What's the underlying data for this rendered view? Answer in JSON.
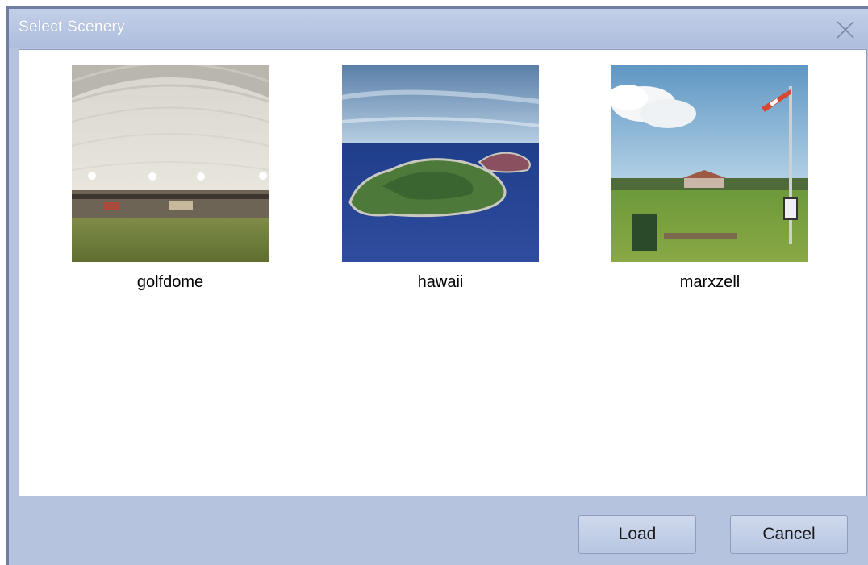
{
  "window": {
    "title": "Select Scenery",
    "close_icon": "close-icon"
  },
  "sceneries": [
    {
      "name": "golfdome",
      "thumbnail_icon": "dome-interior-thumbnail"
    },
    {
      "name": "hawaii",
      "thumbnail_icon": "island-ocean-thumbnail"
    },
    {
      "name": "marxzell",
      "thumbnail_icon": "airfield-windsock-thumbnail"
    }
  ],
  "buttons": {
    "load": "Load",
    "cancel": "Cancel"
  },
  "colors": {
    "frame": "#b5c3de",
    "content_bg": "#ffffff",
    "title_text": "#ffffff"
  }
}
